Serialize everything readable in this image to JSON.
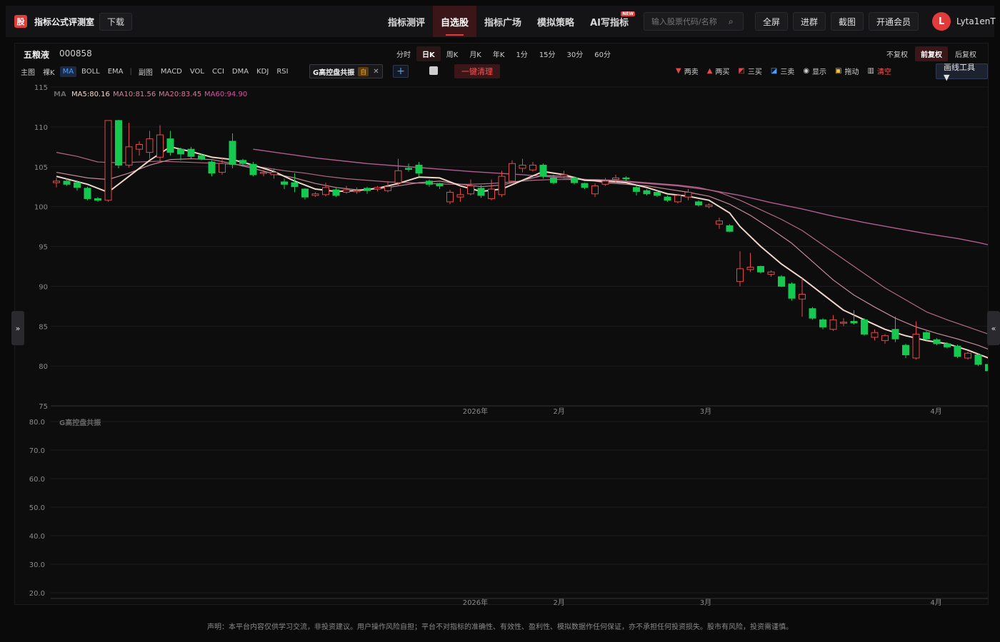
{
  "app": {
    "logo_char": "股",
    "title": "指标公式评测室",
    "download_label": "下载"
  },
  "nav": [
    {
      "label": "指标测评",
      "active": false
    },
    {
      "label": "自选股",
      "active": true
    },
    {
      "label": "指标广场",
      "active": false
    },
    {
      "label": "模拟策略",
      "active": false
    },
    {
      "label": "AI写指标",
      "active": false,
      "badge": "NEW"
    }
  ],
  "search": {
    "placeholder": "输入股票代码/名称"
  },
  "toolbar_buttons": {
    "fullscreen": "全屏",
    "join_group": "进群",
    "screenshot": "截图",
    "membership": "开通会员"
  },
  "user": {
    "avatar_letter": "L",
    "name": "Lyta1enT"
  },
  "stock": {
    "name": "五粮液",
    "code": "000858"
  },
  "periods": [
    "分时",
    "日K",
    "周K",
    "月K",
    "年K",
    "1分",
    "15分",
    "30分",
    "60分"
  ],
  "active_period": "日K",
  "adjust_modes": [
    "不复权",
    "前复权",
    "后复权"
  ],
  "active_adjust": "前复权",
  "indicator_bar": {
    "main_label": "主图",
    "naked_k": "裸K",
    "main_items": [
      "MA",
      "BOLL",
      "EMA"
    ],
    "sub_label": "副图",
    "sub_items": [
      "MACD",
      "VOL",
      "CCI",
      "DMA",
      "KDJ",
      "RSI"
    ]
  },
  "custom_indicator": {
    "name": "G高控盘共振",
    "self_tag": "自"
  },
  "clear_all_label": "一键清理",
  "draw_tools": {
    "two_sell": "两卖",
    "two_buy": "两买",
    "three_buy": "三买",
    "three_sell": "三卖",
    "show": "显示",
    "drag": "拖动",
    "clear": "清空"
  },
  "draw_tool_menu": "画线工具 ▼",
  "ma_legend": {
    "label": "MA",
    "ma5": "MA5:80.16",
    "ma10": "MA10:81.56",
    "ma20": "MA20:83.45",
    "ma60": "MA60:94.90"
  },
  "sub_indicator_label": "G高控盘共振",
  "disclaimer": "声明：本平台内容仅供学习交流，非投资建议。用户操作风险自担；平台不对指标的准确性、有效性、盈利性、模拟数据作任何保证，亦不承担任何投资损失。股市有风险，投资需谨慎。",
  "colors": {
    "up": "#e04a4a",
    "down": "#16c84f",
    "ma5": "#f0d6c8",
    "ma10": "#c48a98",
    "ma20": "#b06a86",
    "ma60": "#b05c90",
    "accent": "#e23b3b"
  },
  "chart_data": {
    "type": "candlestick",
    "main_axis": {
      "ylim": [
        75,
        115
      ],
      "ticks": [
        75,
        80,
        85,
        90,
        95,
        100,
        105,
        110,
        115
      ]
    },
    "sub_axis": {
      "ylim": [
        20,
        80
      ],
      "ticks": [
        "20.0",
        "30.0",
        "40.0",
        "50.0",
        "60.0",
        "70.0",
        "80.0"
      ]
    },
    "x_labels": [
      {
        "label": "2026年",
        "index": 20
      },
      {
        "label": "2月",
        "index": 24
      },
      {
        "label": "3月",
        "index": 31
      },
      {
        "label": "4月",
        "index": 42
      }
    ],
    "candles": [
      [
        103.0,
        103.2,
        102.4,
        103.6
      ],
      [
        103.2,
        102.8,
        102.6,
        103.5
      ],
      [
        103.0,
        102.4,
        102.0,
        103.3
      ],
      [
        102.3,
        101.0,
        100.8,
        102.5
      ],
      [
        101.0,
        100.8,
        100.6,
        101.2
      ],
      [
        100.8,
        110.8,
        100.6,
        110.8
      ],
      [
        110.8,
        105.2,
        104.8,
        110.9
      ],
      [
        105.2,
        107.5,
        104.9,
        110.5
      ],
      [
        107.2,
        107.8,
        106.4,
        108.2
      ],
      [
        106.8,
        108.5,
        106.0,
        109.5
      ],
      [
        106.2,
        109.0,
        105.5,
        110.2
      ],
      [
        108.5,
        106.8,
        106.4,
        109.5
      ],
      [
        107.2,
        106.6,
        105.8,
        107.4
      ],
      [
        107.2,
        106.3,
        106.0,
        107.5
      ],
      [
        106.4,
        106.0,
        105.8,
        106.6
      ],
      [
        105.6,
        104.2,
        103.8,
        105.8
      ],
      [
        104.3,
        105.4,
        104.0,
        106.2
      ],
      [
        108.2,
        105.3,
        104.8,
        109.2
      ],
      [
        105.8,
        105.4,
        105.0,
        106.0
      ],
      [
        105.3,
        104.0,
        103.8,
        105.6
      ],
      [
        104.2,
        104.3,
        103.8,
        104.6
      ],
      [
        104.0,
        104.3,
        103.5,
        104.8
      ],
      [
        103.1,
        102.8,
        102.2,
        103.5
      ],
      [
        103.0,
        102.5,
        101.8,
        104.2
      ],
      [
        102.2,
        101.2,
        100.9,
        102.3
      ],
      [
        101.4,
        101.6,
        101.2,
        101.8
      ],
      [
        101.5,
        102.4,
        101.3,
        103.0
      ],
      [
        102.1,
        101.4,
        101.2,
        102.4
      ],
      [
        101.8,
        102.1,
        101.6,
        102.6
      ],
      [
        102.0,
        102.0,
        101.6,
        102.4
      ],
      [
        102.3,
        102.0,
        101.6,
        102.5
      ],
      [
        102.2,
        102.4,
        101.9,
        102.6
      ],
      [
        102.0,
        102.5,
        101.8,
        103.2
      ],
      [
        103.0,
        104.5,
        102.6,
        106.0
      ],
      [
        104.8,
        104.7,
        104.4,
        105.4
      ],
      [
        105.2,
        104.2,
        103.8,
        105.6
      ],
      [
        103.2,
        102.8,
        102.5,
        103.4
      ],
      [
        102.9,
        102.6,
        102.2,
        103.0
      ],
      [
        100.6,
        101.8,
        100.3,
        102.1
      ],
      [
        101.2,
        101.5,
        100.6,
        102.3
      ],
      [
        101.6,
        102.6,
        101.4,
        103.4
      ],
      [
        102.3,
        101.4,
        101.1,
        102.7
      ],
      [
        101.0,
        102.2,
        100.8,
        103.4
      ],
      [
        101.5,
        103.8,
        101.2,
        104.5
      ],
      [
        103.2,
        105.4,
        103.0,
        105.8
      ],
      [
        104.8,
        105.2,
        104.3,
        106.0
      ],
      [
        104.6,
        105.2,
        104.4,
        105.6
      ],
      [
        105.2,
        103.8,
        103.5,
        105.4
      ],
      [
        103.6,
        103.0,
        102.8,
        104.0
      ],
      [
        103.8,
        104.0,
        103.5,
        104.5
      ],
      [
        103.6,
        103.0,
        102.8,
        103.8
      ],
      [
        102.9,
        102.4,
        102.2,
        103.0
      ],
      [
        101.6,
        102.6,
        101.2,
        102.9
      ],
      [
        102.8,
        103.2,
        102.6,
        103.6
      ],
      [
        103.4,
        103.6,
        103.0,
        104.0
      ],
      [
        103.6,
        103.5,
        103.2,
        103.8
      ],
      [
        102.4,
        101.9,
        101.4,
        102.6
      ],
      [
        102.0,
        101.6,
        101.4,
        102.2
      ],
      [
        101.8,
        101.4,
        101.2,
        102.0
      ],
      [
        101.2,
        100.8,
        100.6,
        101.4
      ],
      [
        100.6,
        101.4,
        100.4,
        101.6
      ],
      [
        101.2,
        101.8,
        100.8,
        102.2
      ],
      [
        100.6,
        100.2,
        100.0,
        100.8
      ],
      [
        100.0,
        100.2,
        99.8,
        100.4
      ],
      [
        97.8,
        98.2,
        97.2,
        98.6
      ],
      [
        97.6,
        96.9,
        96.8,
        97.8
      ],
      [
        90.6,
        92.2,
        90.0,
        94.4
      ],
      [
        92.1,
        92.4,
        91.8,
        94.2
      ],
      [
        92.5,
        91.8,
        91.6,
        92.6
      ],
      [
        91.5,
        91.8,
        91.2,
        92.0
      ],
      [
        91.2,
        90.0,
        89.9,
        91.4
      ],
      [
        90.3,
        88.5,
        88.2,
        90.5
      ],
      [
        88.4,
        89.0,
        86.2,
        91.0
      ],
      [
        87.2,
        86.0,
        85.8,
        87.4
      ],
      [
        85.8,
        84.9,
        84.6,
        86.0
      ],
      [
        84.6,
        85.8,
        84.4,
        86.4
      ],
      [
        85.4,
        85.5,
        85.0,
        86.0
      ],
      [
        85.6,
        85.4,
        85.2,
        87.0
      ],
      [
        85.8,
        84.0,
        83.8,
        86.0
      ],
      [
        83.6,
        84.2,
        83.2,
        84.6
      ],
      [
        83.2,
        83.8,
        82.8,
        84.0
      ],
      [
        84.6,
        83.4,
        83.0,
        86.2
      ],
      [
        82.6,
        81.4,
        81.0,
        82.8
      ],
      [
        81.0,
        84.0,
        80.8,
        85.6
      ],
      [
        84.2,
        83.4,
        83.2,
        84.4
      ],
      [
        83.3,
        82.8,
        82.6,
        83.5
      ],
      [
        82.8,
        82.4,
        82.2,
        83.0
      ],
      [
        82.5,
        81.2,
        81.0,
        82.7
      ],
      [
        81.0,
        81.6,
        80.8,
        81.8
      ],
      [
        81.4,
        80.2,
        80.0,
        81.5
      ],
      [
        80.2,
        79.4,
        79.2,
        80.3
      ],
      [
        79.2,
        79.6,
        78.8,
        79.8
      ]
    ],
    "ma5": [
      [
        0,
        103.8
      ],
      [
        3,
        102.8
      ],
      [
        5,
        101.8
      ],
      [
        7,
        103.8
      ],
      [
        9,
        105.8
      ],
      [
        11,
        107.5
      ],
      [
        13,
        106.9
      ],
      [
        15,
        106.2
      ],
      [
        17,
        105.9
      ],
      [
        19,
        105.2
      ],
      [
        21,
        104.4
      ],
      [
        23,
        103.2
      ],
      [
        25,
        102.2
      ],
      [
        27,
        101.9
      ],
      [
        29,
        102.0
      ],
      [
        31,
        102.3
      ],
      [
        33,
        102.9
      ],
      [
        35,
        103.7
      ],
      [
        37,
        103.6
      ],
      [
        39,
        102.6
      ],
      [
        41,
        101.9
      ],
      [
        43,
        102.2
      ],
      [
        45,
        103.3
      ],
      [
        47,
        104.4
      ],
      [
        49,
        104.0
      ],
      [
        51,
        103.3
      ],
      [
        53,
        103.2
      ],
      [
        55,
        103.0
      ],
      [
        57,
        102.4
      ],
      [
        59,
        101.6
      ],
      [
        61,
        101.3
      ],
      [
        63,
        100.8
      ],
      [
        65,
        99.2
      ],
      [
        66,
        97.5
      ],
      [
        68,
        95.0
      ],
      [
        70,
        92.8
      ],
      [
        72,
        91.0
      ],
      [
        74,
        89.0
      ],
      [
        76,
        87.0
      ],
      [
        78,
        85.8
      ],
      [
        80,
        84.6
      ],
      [
        82,
        83.8
      ],
      [
        84,
        83.2
      ],
      [
        86,
        82.8
      ],
      [
        88,
        82.0
      ],
      [
        90,
        81.0
      ],
      [
        91,
        80.2
      ]
    ],
    "ma10": [
      [
        0,
        104.3
      ],
      [
        3,
        103.6
      ],
      [
        5,
        103.4
      ],
      [
        7,
        104.2
      ],
      [
        9,
        105.2
      ],
      [
        11,
        105.9
      ],
      [
        13,
        106.0
      ],
      [
        15,
        105.9
      ],
      [
        17,
        105.4
      ],
      [
        19,
        104.8
      ],
      [
        21,
        104.1
      ],
      [
        23,
        103.6
      ],
      [
        25,
        102.9
      ],
      [
        27,
        102.4
      ],
      [
        29,
        102.1
      ],
      [
        31,
        102.2
      ],
      [
        33,
        102.6
      ],
      [
        35,
        103.0
      ],
      [
        37,
        103.2
      ],
      [
        39,
        102.8
      ],
      [
        41,
        102.5
      ],
      [
        43,
        102.7
      ],
      [
        45,
        103.3
      ],
      [
        47,
        103.9
      ],
      [
        49,
        103.8
      ],
      [
        51,
        103.4
      ],
      [
        53,
        103.0
      ],
      [
        55,
        102.8
      ],
      [
        57,
        102.6
      ],
      [
        59,
        102.2
      ],
      [
        61,
        101.8
      ],
      [
        63,
        101.3
      ],
      [
        65,
        100.3
      ],
      [
        67,
        98.9
      ],
      [
        69,
        97.2
      ],
      [
        71,
        95.4
      ],
      [
        73,
        93.1
      ],
      [
        75,
        90.8
      ],
      [
        77,
        88.9
      ],
      [
        79,
        87.4
      ],
      [
        81,
        86.0
      ],
      [
        83,
        84.9
      ],
      [
        85,
        84.1
      ],
      [
        87,
        83.4
      ],
      [
        89,
        82.6
      ],
      [
        91,
        81.6
      ]
    ],
    "ma20": [
      [
        0,
        106.8
      ],
      [
        2,
        106.3
      ],
      [
        4,
        105.6
      ],
      [
        6,
        105.5
      ],
      [
        8,
        105.6
      ],
      [
        10,
        105.7
      ],
      [
        12,
        105.6
      ],
      [
        14,
        105.5
      ],
      [
        16,
        105.4
      ],
      [
        18,
        105.2
      ],
      [
        20,
        104.9
      ],
      [
        22,
        104.5
      ],
      [
        24,
        104.2
      ],
      [
        26,
        103.8
      ],
      [
        28,
        103.5
      ],
      [
        30,
        103.3
      ],
      [
        32,
        103.1
      ],
      [
        34,
        103.0
      ],
      [
        36,
        102.9
      ],
      [
        38,
        102.8
      ],
      [
        40,
        102.8
      ],
      [
        42,
        102.9
      ],
      [
        44,
        103.1
      ],
      [
        46,
        103.3
      ],
      [
        48,
        103.4
      ],
      [
        50,
        103.4
      ],
      [
        52,
        103.4
      ],
      [
        54,
        103.3
      ],
      [
        56,
        103.1
      ],
      [
        58,
        102.9
      ],
      [
        60,
        102.7
      ],
      [
        62,
        102.4
      ],
      [
        64,
        101.8
      ],
      [
        66,
        100.8
      ],
      [
        68,
        99.6
      ],
      [
        70,
        98.4
      ],
      [
        72,
        97.0
      ],
      [
        74,
        95.2
      ],
      [
        76,
        93.4
      ],
      [
        78,
        91.6
      ],
      [
        80,
        89.8
      ],
      [
        82,
        88.3
      ],
      [
        84,
        86.8
      ],
      [
        86,
        85.8
      ],
      [
        88,
        84.9
      ],
      [
        90,
        84.0
      ],
      [
        91,
        83.4
      ]
    ],
    "ma60": [
      [
        19,
        107.2
      ],
      [
        25,
        106.1
      ],
      [
        30,
        105.4
      ],
      [
        35,
        104.9
      ],
      [
        40,
        104.4
      ],
      [
        45,
        104.0
      ],
      [
        50,
        103.5
      ],
      [
        55,
        103.1
      ],
      [
        60,
        102.6
      ],
      [
        63,
        102.1
      ],
      [
        66,
        101.4
      ],
      [
        69,
        100.5
      ],
      [
        72,
        99.7
      ],
      [
        75,
        98.8
      ],
      [
        78,
        98.0
      ],
      [
        81,
        97.3
      ],
      [
        84,
        96.6
      ],
      [
        87,
        96.0
      ],
      [
        89,
        95.5
      ],
      [
        91,
        94.9
      ]
    ]
  }
}
